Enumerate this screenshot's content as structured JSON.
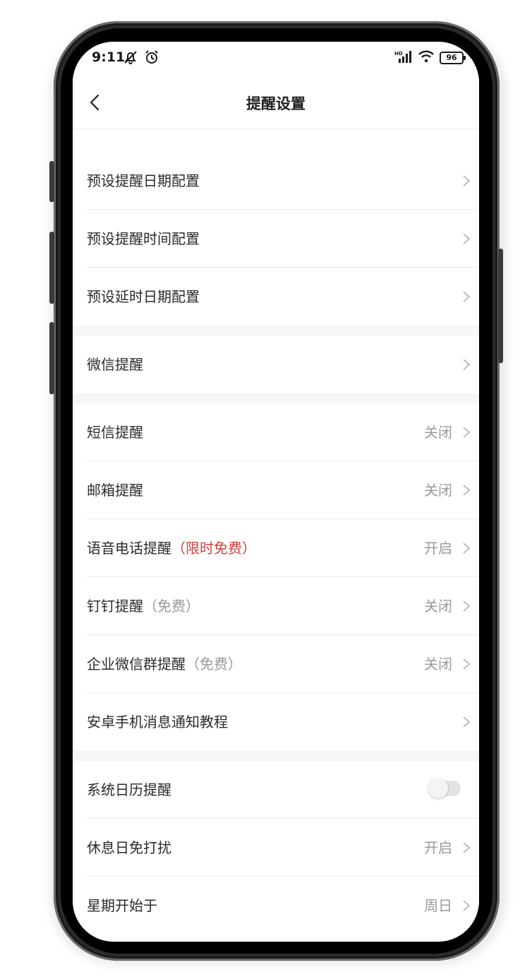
{
  "status_bar": {
    "time": "9:11",
    "battery": "96",
    "icons_left": [
      "mute-icon",
      "alarm-icon"
    ],
    "icons_right": [
      "signal-icon",
      "wifi-icon",
      "battery-icon"
    ]
  },
  "header": {
    "title": "提醒设置",
    "back_icon": "chevron-left-icon"
  },
  "settings": {
    "preset_date": {
      "label": "预设提醒日期配置"
    },
    "preset_time": {
      "label": "预设提醒时间配置"
    },
    "preset_delay": {
      "label": "预设延时日期配置"
    },
    "wechat": {
      "label": "微信提醒"
    },
    "sms": {
      "label": "短信提醒",
      "value": "关闭"
    },
    "email": {
      "label": "邮箱提醒",
      "value": "关闭"
    },
    "voice_call": {
      "label": "语音电话提醒",
      "badge": "（限时免费）",
      "value": "开启"
    },
    "dingtalk": {
      "label": "钉钉提醒",
      "badge": "（免费）",
      "value": "关闭"
    },
    "wecom_group": {
      "label": "企业微信群提醒",
      "badge": "（免费）",
      "value": "关闭"
    },
    "android_tutorial": {
      "label": "安卓手机消息通知教程"
    },
    "system_calendar": {
      "label": "系统日历提醒",
      "enabled": false
    },
    "holiday_dnd": {
      "label": "休息日免打扰",
      "value": "开启"
    },
    "week_start": {
      "label": "星期开始于",
      "value": "周日"
    }
  },
  "colors": {
    "accent_red": "#c9433f",
    "value_grey": "#9a9a9a",
    "group_gap": "#f6f6f6"
  }
}
